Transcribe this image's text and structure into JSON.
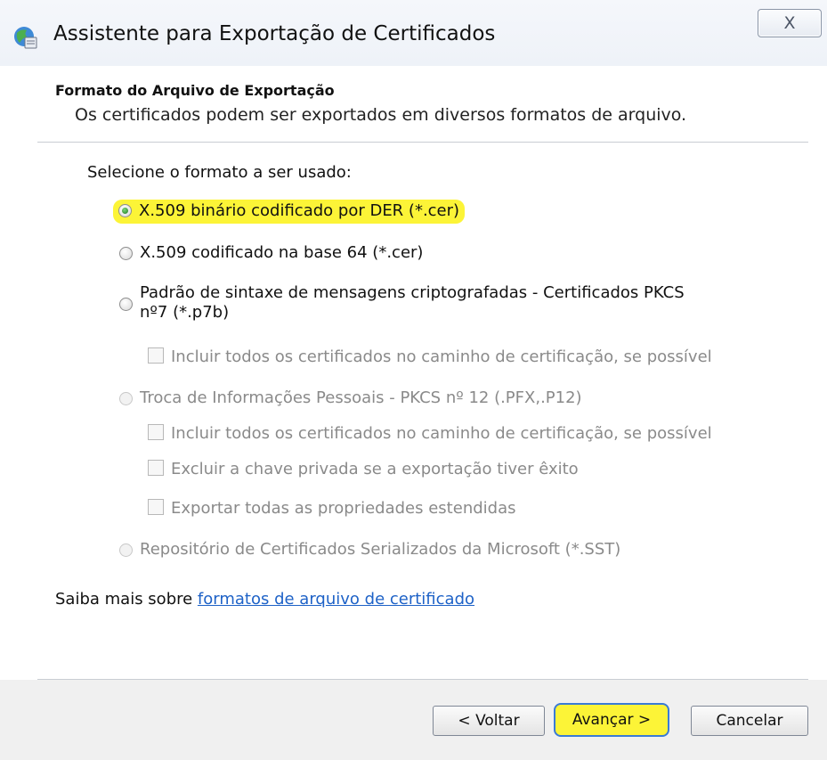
{
  "window": {
    "title": "Assistente para Exportação de Certificados",
    "close_label": "X"
  },
  "header": {
    "section_title": "Formato do Arquivo de Exportação",
    "section_subtitle": "Os certificados podem ser exportados em diversos formatos de arquivo."
  },
  "content": {
    "prompt": "Selecione o formato a ser usado:",
    "options": [
      {
        "label": "X.509 binário codificado por DER (*.cer)",
        "selected": true,
        "enabled": true,
        "highlighted": true
      },
      {
        "label": "X.509 codificado na base 64 (*.cer)",
        "selected": false,
        "enabled": true
      },
      {
        "label": "Padrão de sintaxe de mensagens criptografadas - Certificados PKCS nº7 (*.p7b)",
        "selected": false,
        "enabled": true
      },
      {
        "label": "Troca de Informações Pessoais - PKCS nº 12 (.PFX,.P12)",
        "selected": false,
        "enabled": false
      },
      {
        "label": "Repositório de Certificados Serializados da Microsoft (*.SST)",
        "selected": false,
        "enabled": false
      }
    ],
    "checkboxes": {
      "p7b_include_all": "Incluir todos os certificados no caminho de certificação, se possível",
      "pfx_include_all": "Incluir todos os certificados no caminho de certificação, se possível",
      "pfx_delete_key": "Excluir a chave privada se a exportação tiver êxito",
      "pfx_export_props": "Exportar todas as propriedades estendidas"
    },
    "learn_more_prefix": "Saiba mais sobre ",
    "learn_more_link": "formatos de arquivo de certificado"
  },
  "buttons": {
    "back": "< Voltar",
    "next": "Avançar >",
    "cancel": "Cancelar"
  },
  "colors": {
    "highlight": "#fcf437",
    "link": "#1e62c7",
    "primary_border": "#3a7bd5"
  }
}
